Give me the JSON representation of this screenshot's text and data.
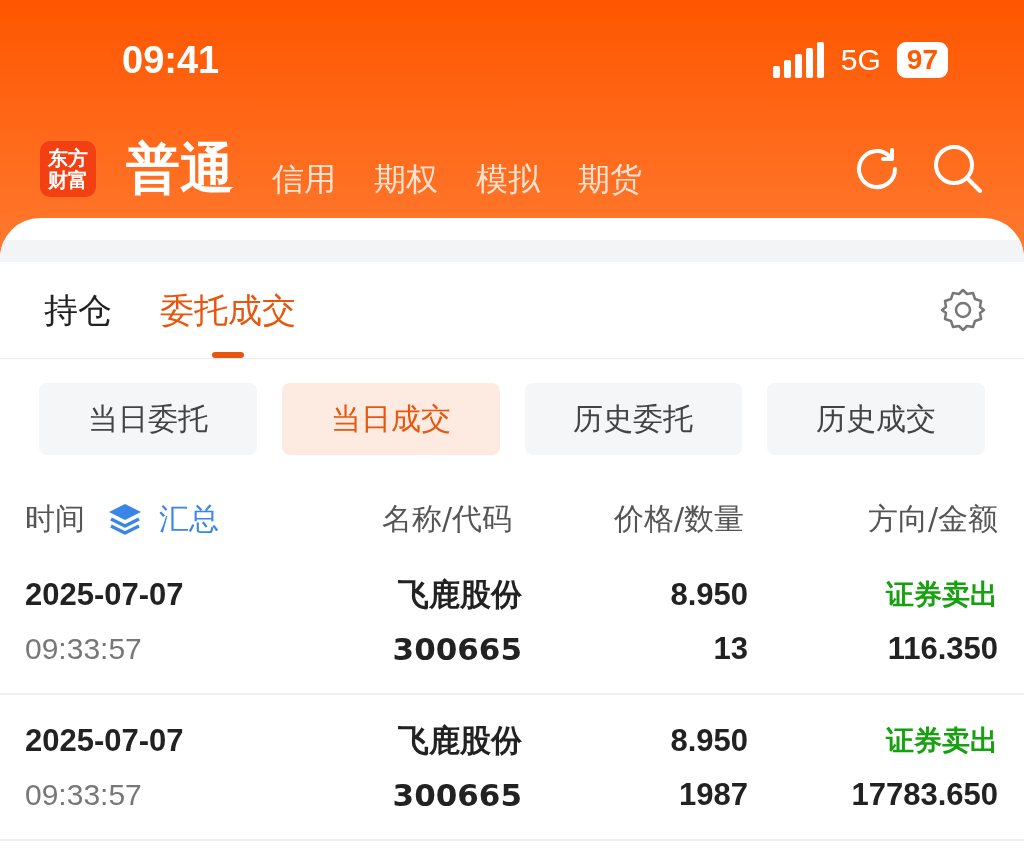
{
  "status_bar": {
    "time": "09:41",
    "network": "5G",
    "battery": "97"
  },
  "header": {
    "logo": [
      "东方",
      "财富"
    ],
    "tabs": [
      {
        "label": "普通",
        "selected": true
      },
      {
        "label": "信用",
        "selected": false
      },
      {
        "label": "期权",
        "selected": false
      },
      {
        "label": "模拟",
        "selected": false
      },
      {
        "label": "期货",
        "selected": false
      }
    ]
  },
  "tabs": [
    {
      "label": "持仓",
      "selected": false
    },
    {
      "label": "委托成交",
      "selected": true
    }
  ],
  "segments": [
    {
      "label": "当日委托",
      "selected": false
    },
    {
      "label": "当日成交",
      "selected": true
    },
    {
      "label": "历史委托",
      "selected": false
    },
    {
      "label": "历史成交",
      "selected": false
    }
  ],
  "table": {
    "columns": [
      "时间",
      "名称/代码",
      "价格/数量",
      "方向/金额"
    ],
    "summary": "汇总",
    "rows": [
      {
        "date": "2025-07-07",
        "time": "09:33:57",
        "name": "飞鹿股份",
        "code": "300665",
        "price": "8.950",
        "quantity": "13",
        "direction": "证券卖出",
        "amount": "116.350"
      },
      {
        "date": "2025-07-07",
        "time": "09:33:57",
        "name": "飞鹿股份",
        "code": "300665",
        "price": "8.950",
        "quantity": "1987",
        "direction": "证券卖出",
        "amount": "17783.650"
      }
    ]
  }
}
